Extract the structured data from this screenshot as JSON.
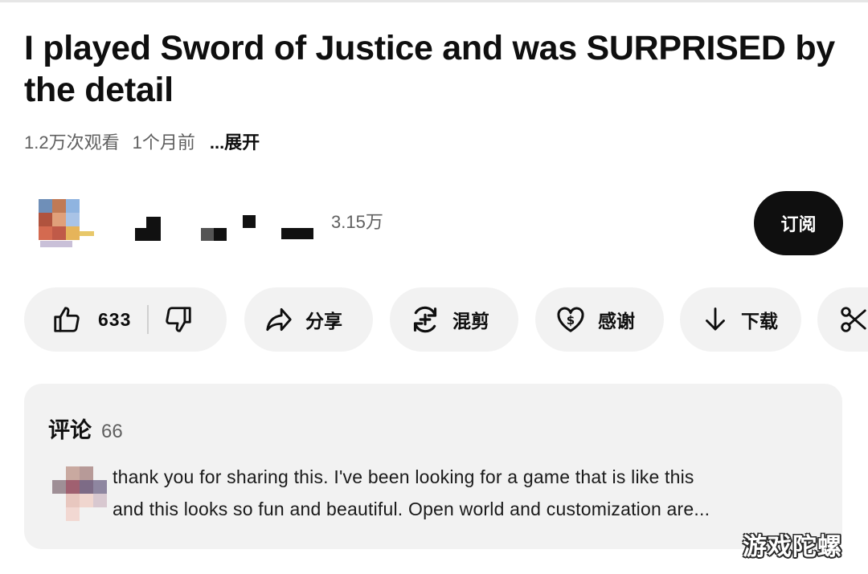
{
  "video": {
    "title": "I played Sword of Justice and was SURPRISED by the detail",
    "views": "1.2万次观看",
    "age": "1个月前",
    "expand_label": "...展开"
  },
  "channel": {
    "subscribers": "3.15万",
    "subscribe_label": "订阅"
  },
  "actions": {
    "like_count": "633",
    "share_label": "分享",
    "remix_label": "混剪",
    "thanks_label": "感谢",
    "download_label": "下载",
    "icons": [
      "thumbs-up-icon",
      "thumbs-down-icon",
      "share-arrow-icon",
      "remix-icon",
      "heart-dollar-icon",
      "download-arrow-icon",
      "scissors-icon"
    ]
  },
  "comments": {
    "label": "评论",
    "count": "66",
    "top_comment": {
      "line1": "thank you for sharing this. I've been looking for a game that is like this",
      "line2": "and this looks so fun and beautiful.  Open world and customization are..."
    }
  },
  "watermark": "游戏陀螺",
  "colors": {
    "text_primary": "#0f0f0f",
    "text_secondary": "#606060",
    "pill_background": "#f2f2f2",
    "subscribe_background": "#0f0f0f"
  }
}
